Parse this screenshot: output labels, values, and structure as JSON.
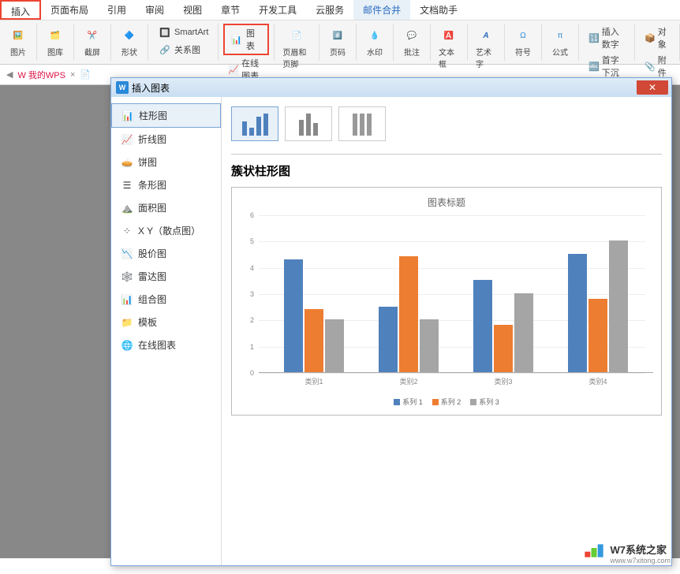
{
  "menu": {
    "items": [
      "插入",
      "页面布局",
      "引用",
      "审阅",
      "视图",
      "章节",
      "开发工具",
      "云服务",
      "邮件合并",
      "文档助手"
    ]
  },
  "ribbon": {
    "picture": "图片",
    "gallery": "图库",
    "screenshot": "截屏",
    "shapes": "形状",
    "smartart": "SmartArt",
    "relation": "关系图",
    "chart": "图表",
    "online_chart": "在线图表",
    "header_footer": "页眉和页脚",
    "page_number": "页码",
    "watermark": "水印",
    "comment": "批注",
    "textbox": "文本框",
    "wordart": "艺术字",
    "symbol": "符号",
    "equation": "公式",
    "insert_number": "插入数字",
    "object": "对象",
    "dropcap": "首字下沉",
    "attachment": "附件"
  },
  "tabs": {
    "mywps": "我的WPS"
  },
  "dialog": {
    "title": "插入图表",
    "sidebar": {
      "items": [
        {
          "label": "柱形图"
        },
        {
          "label": "折线图"
        },
        {
          "label": "饼图"
        },
        {
          "label": "条形图"
        },
        {
          "label": "面积图"
        },
        {
          "label": "X Y（散点图）"
        },
        {
          "label": "股价图"
        },
        {
          "label": "雷达图"
        },
        {
          "label": "组合图"
        },
        {
          "label": "模板"
        },
        {
          "label": "在线图表"
        }
      ]
    },
    "section_title": "簇状柱形图",
    "chart_title": "图表标题"
  },
  "chart_data": {
    "type": "bar",
    "title": "图表标题",
    "categories": [
      "类别1",
      "类别2",
      "类别3",
      "类别4"
    ],
    "series": [
      {
        "name": "系列 1",
        "values": [
          4.3,
          2.5,
          3.5,
          4.5
        ],
        "color": "#4f81bd"
      },
      {
        "name": "系列 2",
        "values": [
          2.4,
          4.4,
          1.8,
          2.8
        ],
        "color": "#ed7d31"
      },
      {
        "name": "系列 3",
        "values": [
          2.0,
          2.0,
          3.0,
          5.0
        ],
        "color": "#a5a5a5"
      }
    ],
    "ylim": [
      0,
      6
    ],
    "yticks": [
      0,
      1,
      2,
      3,
      4,
      5,
      6
    ]
  },
  "watermark": {
    "title": "W7系统之家",
    "url": "www.w7xitong.com"
  }
}
